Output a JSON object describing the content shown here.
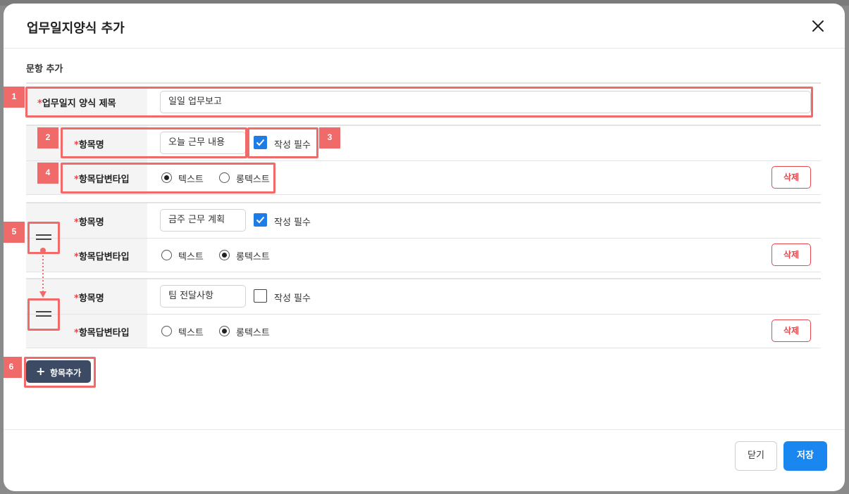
{
  "modal": {
    "title": "업무일지양식 추가",
    "section_title": "문항 추가"
  },
  "title_field": {
    "required_mark": "*",
    "label": "업무일지 양식 제목",
    "value": "일일 업무보고"
  },
  "item_labels": {
    "required_mark": "*",
    "name_label": "항목명",
    "type_label": "항목답변타입",
    "required_check_label": "작성 필수",
    "option_text": "텍스트",
    "option_longtext": "롱텍스트",
    "delete_label": "삭제"
  },
  "items": [
    {
      "name": "오늘 근무 내용",
      "required": true,
      "type": "텍스트"
    },
    {
      "name": "금주 근무 계획",
      "required": true,
      "type": "롱텍스트"
    },
    {
      "name": "팀 전달사항",
      "required": false,
      "type": "롱텍스트"
    }
  ],
  "add_button": {
    "label": "항목추가",
    "icon": "plus-icon"
  },
  "footer": {
    "close_label": "닫기",
    "save_label": "저장"
  },
  "annotations": [
    "1",
    "2",
    "3",
    "4",
    "5",
    "6"
  ],
  "colors": {
    "accent": "#1a86f0",
    "danger": "#e5484d",
    "annotation": "#f06a6a",
    "dark_button": "#3c4a63"
  }
}
